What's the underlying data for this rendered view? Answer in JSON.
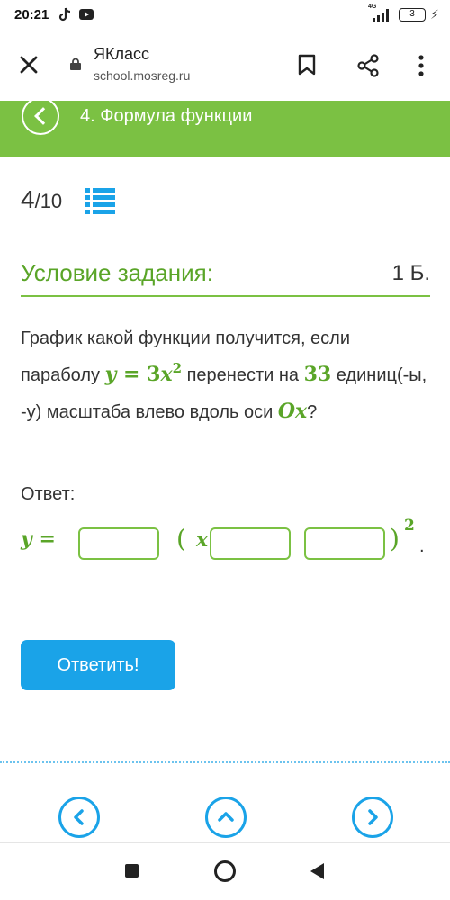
{
  "status_bar": {
    "time": "20:21",
    "network": "4G",
    "battery": "3"
  },
  "browser": {
    "site_title": "ЯКласс",
    "url": "school.mosreg.ru"
  },
  "lesson": {
    "title": "4. Формула функции"
  },
  "counter": {
    "current": "4",
    "total": "/10"
  },
  "task": {
    "heading": "Условие задания:",
    "points": "1 Б.",
    "question_parts": {
      "p1": "График какой функции получится, если параболу ",
      "formula_lhs": "y",
      "formula_eq": " = ",
      "formula_coef": "3",
      "formula_var": "x",
      "formula_exp": "2",
      "p2": " перенести на ",
      "shift": "33",
      "p3": " единиц(-ы, -у) масштаба влево вдоль оси ",
      "axis": "Ox",
      "p4": "?"
    }
  },
  "answer": {
    "label": "Ответ:",
    "lhs": "y =",
    "open_paren": "(",
    "x": "x",
    "close_paren": ")",
    "exponent": "2",
    "period": ".",
    "inputs": [
      "",
      "",
      ""
    ]
  },
  "submit": {
    "label": "Ответить!"
  },
  "colors": {
    "accent_green": "#7bc143",
    "math_green": "#5aa528",
    "accent_blue": "#1aa3e8"
  }
}
